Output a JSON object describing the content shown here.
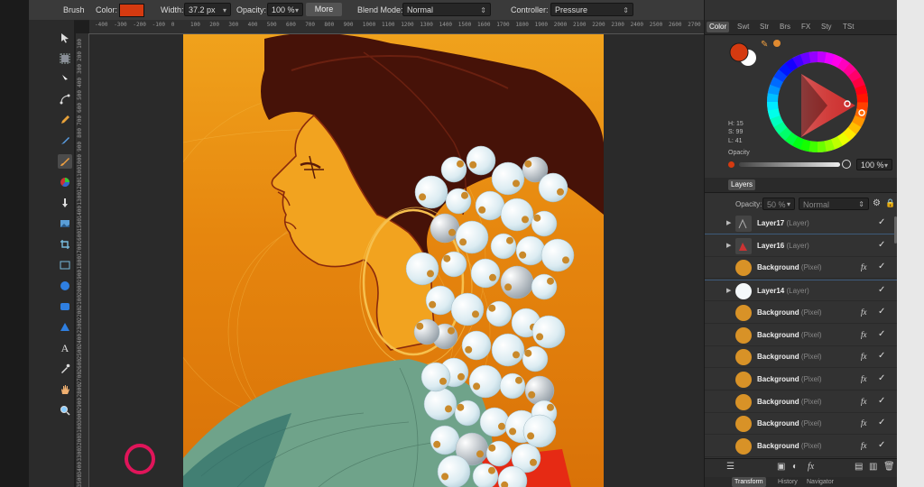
{
  "context_toolbar": {
    "tool_name": "Brush",
    "color_label": "Color:",
    "color_value": "#d53a10",
    "width_label": "Width:",
    "width_value": "37.2 px",
    "opacity_label": "Opacity:",
    "opacity_value": "100 %",
    "more_label": "More",
    "blend_mode_label": "Blend Mode:",
    "blend_mode_value": "Normal",
    "controller_label": "Controller:",
    "controller_value": "Pressure"
  },
  "ruler": {
    "h_ticks": [
      "-400",
      "-300",
      "-200",
      "-100",
      "0",
      "100",
      "200",
      "300",
      "400",
      "500",
      "600",
      "700",
      "800",
      "900",
      "1000",
      "1100",
      "1200",
      "1300",
      "1400",
      "1500",
      "1600",
      "1700",
      "1800",
      "1900",
      "2000",
      "2100",
      "2200",
      "2300",
      "2400",
      "2500",
      "2600",
      "2700"
    ],
    "v_ticks": [
      "100",
      "200",
      "300",
      "400",
      "500",
      "600",
      "700",
      "800",
      "900",
      "1000",
      "1100",
      "1200",
      "1300",
      "1400",
      "1500",
      "1600",
      "1700",
      "1800",
      "1900",
      "2000",
      "2100",
      "2200",
      "2300",
      "2400",
      "2500",
      "2600",
      "2700",
      "2800",
      "2900",
      "3000",
      "3100",
      "3200",
      "3300",
      "3400",
      "3500"
    ]
  },
  "color_panel": {
    "tabs": [
      "Color",
      "Swt",
      "Str",
      "Brs",
      "FX",
      "Sty",
      "TSt"
    ],
    "active_tab": "Color",
    "h": "H: 15",
    "s": "S: 99",
    "l": "L: 41",
    "opacity_label": "Opacity",
    "opacity_value": "100 %",
    "primary_color": "#d53a10"
  },
  "layers_panel": {
    "title": "Layers",
    "opacity_label": "Opacity:",
    "opacity_value": "50 %",
    "blend_value": "Normal",
    "layers": [
      {
        "name": "Layer17",
        "type": "(Layer)",
        "fx": false
      },
      {
        "name": "Layer16",
        "type": "(Layer)",
        "fx": false
      },
      {
        "name": "Background",
        "type": "(Pixel)",
        "fx": true
      },
      {
        "name": "Layer14",
        "type": "(Layer)",
        "fx": false
      },
      {
        "name": "Background",
        "type": "(Pixel)",
        "fx": true
      },
      {
        "name": "Background",
        "type": "(Pixel)",
        "fx": true
      },
      {
        "name": "Background",
        "type": "(Pixel)",
        "fx": true
      },
      {
        "name": "Background",
        "type": "(Pixel)",
        "fx": true
      },
      {
        "name": "Background",
        "type": "(Pixel)",
        "fx": true
      },
      {
        "name": "Background",
        "type": "(Pixel)",
        "fx": true
      },
      {
        "name": "Background",
        "type": "(Pixel)",
        "fx": true
      }
    ],
    "fx_label": "fx"
  },
  "bottom_tabs": [
    "Transform",
    "History",
    "Navigator"
  ],
  "icons": [
    "move-icon",
    "marquee-icon",
    "node-icon",
    "pen-icon",
    "pencil-icon",
    "paint-brush-icon",
    "color-picker-icon",
    "fill-icon",
    "image-icon",
    "crop-icon",
    "ellipse-icon",
    "rounded-rect-icon",
    "triangle-icon",
    "text-icon",
    "eyedropper-icon",
    "hand-icon",
    "zoom-icon"
  ]
}
